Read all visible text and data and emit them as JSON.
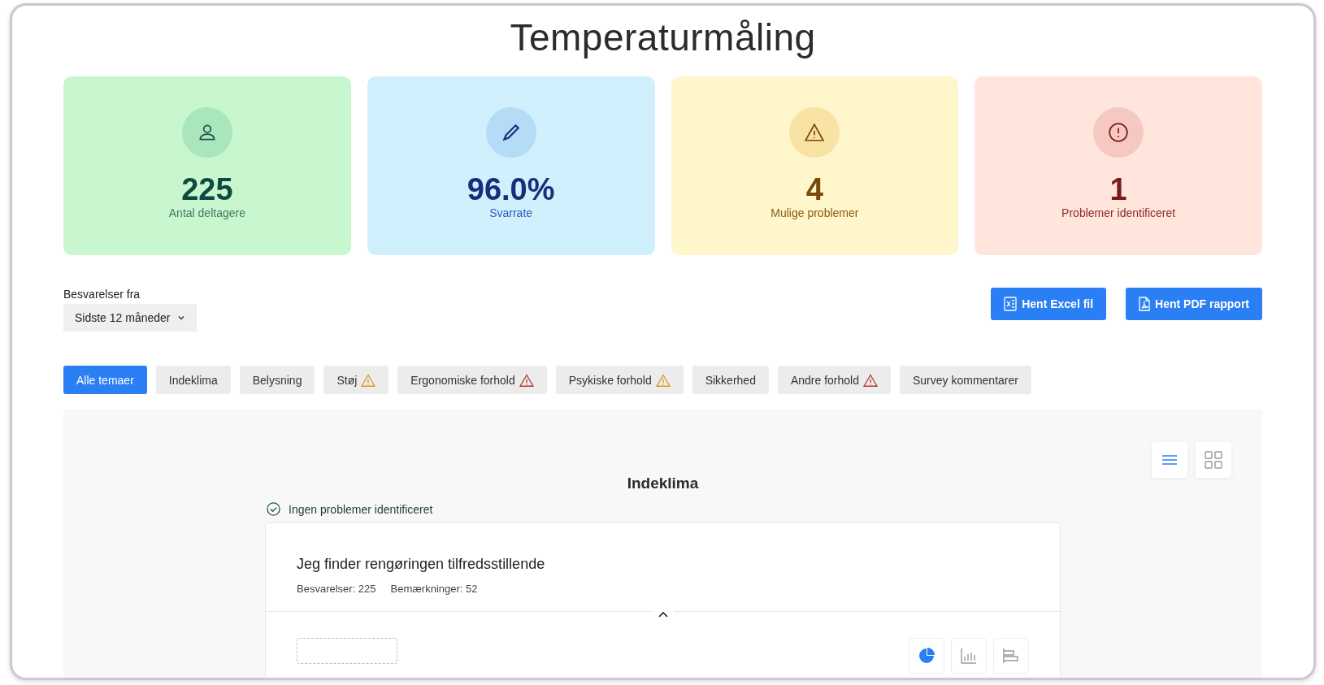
{
  "title": "Temperaturmåling",
  "stats": [
    {
      "kind": "participants",
      "value": "225",
      "label": "Antal deltagere"
    },
    {
      "kind": "response",
      "value": "96.0%",
      "label": "Svarrate"
    },
    {
      "kind": "possible",
      "value": "4",
      "label": "Mulige problemer"
    },
    {
      "kind": "identified",
      "value": "1",
      "label": "Problemer identificeret"
    }
  ],
  "filter": {
    "label": "Besvarelser fra",
    "value": "Sidste 12 måneder"
  },
  "actions": [
    {
      "kind": "excel",
      "label": "Hent Excel fil"
    },
    {
      "kind": "pdf",
      "label": "Hent PDF rapport"
    }
  ],
  "tabs": [
    {
      "label": "Alle temaer",
      "selected": true,
      "warning": false
    },
    {
      "label": "Indeklima",
      "selected": false,
      "warning": false
    },
    {
      "label": "Belysning",
      "selected": false,
      "warning": false
    },
    {
      "label": "Støj",
      "selected": false,
      "warning": true,
      "color": "#d99a1c"
    },
    {
      "label": "Ergonomiske forhold",
      "selected": false,
      "warning": true,
      "color": "#b03a2e"
    },
    {
      "label": "Psykiske forhold",
      "selected": false,
      "warning": true,
      "color": "#d99a1c"
    },
    {
      "label": "Sikkerhed",
      "selected": false,
      "warning": false
    },
    {
      "label": "Andre forhold",
      "selected": false,
      "warning": true,
      "color": "#b03a2e"
    },
    {
      "label": "Survey kommentarer",
      "selected": false,
      "warning": false
    }
  ],
  "view_toggle": [
    {
      "kind": "list",
      "selected": true
    },
    {
      "kind": "grid",
      "selected": false
    }
  ],
  "section": {
    "title": "Indeklima",
    "status": "Ingen problemer identificeret",
    "question": {
      "text": "Jeg finder rengøringen tilfredsstillende",
      "responses": "Besvarelser: 225",
      "remarks": "Bemærkninger: 52",
      "chart_types": [
        {
          "kind": "pie",
          "selected": true
        },
        {
          "kind": "bar",
          "selected": false
        },
        {
          "kind": "hbar",
          "selected": false
        }
      ]
    }
  }
}
